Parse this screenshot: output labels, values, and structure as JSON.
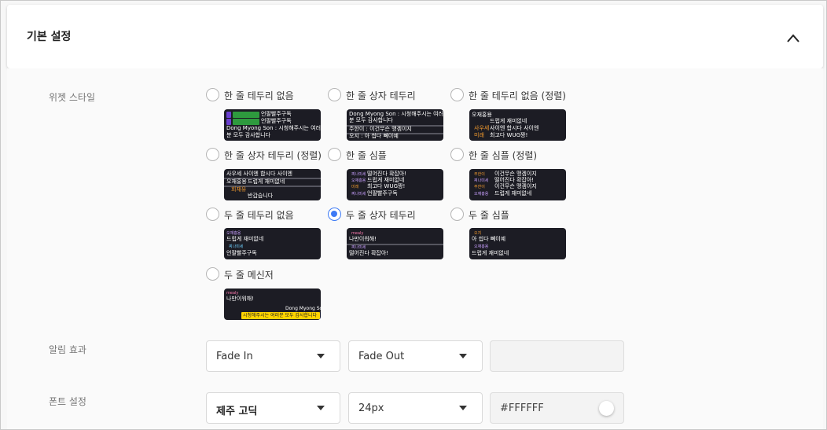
{
  "section": {
    "title": "기본 설정",
    "collapse_icon": "chevron-up-icon"
  },
  "widget_style": {
    "label": "위젯 스타일",
    "selected": "두 줄 상자 테두리",
    "options": [
      {
        "label": "한 줄 테두리 없음",
        "checked": false
      },
      {
        "label": "한 줄 상자 테두리",
        "checked": false
      },
      {
        "label": "한 줄 테두리 없음 (정렬)",
        "checked": false
      },
      {
        "label": "한 줄 상자 테두리 (정렬)",
        "checked": false
      },
      {
        "label": "한 줄 심플",
        "checked": false
      },
      {
        "label": "한 줄 심플 (정렬)",
        "checked": false
      },
      {
        "label": "두 줄 테두리 없음",
        "checked": false
      },
      {
        "label": "두 줄 상자 테두리",
        "checked": true
      },
      {
        "label": "두 줄 심플",
        "checked": false
      },
      {
        "label": "두 줄 메신저",
        "checked": false
      }
    ],
    "previews": {
      "p1": [
        "Dong Myong Son : 시청해주시는 여러",
        "분 모두 감사합니다",
        "언팔빨주구독",
        "언팔빨주구독"
      ],
      "p2": [
        "Dong Myong Son : 시청해주시는 여러",
        "분 모두 감사합니다",
        "주한이 : 이건무슨 맹겜이지",
        "오지 : 아 씹다 뻬이예"
      ],
      "p3": [
        "오재홍용",
        "드럽게 재미없네",
        "사우세",
        "사이엔 합시다 사이엔",
        "미래",
        "최고다 WUG짱!"
      ],
      "p4": [
        "사우세 사이엔 합시다 사이엔",
        "오재홍용",
        "드럽게 재미없네",
        "회재유",
        "반갑습니다"
      ],
      "p5": [
        "찌나미세",
        "떨어진다 확잡아!",
        "오재홍용",
        "드럽게 재미없네",
        "미래",
        "최고다 WUG짱!",
        "찌나미세",
        "언팔빨주구독"
      ],
      "p6": [
        "주한이",
        "이건무슨 맹겜이지",
        "찌나미세",
        "떨어진다 확잡아!",
        "주한이",
        "이건무슨 맹겜이지",
        "오재홍용",
        "드럽게 재미없네"
      ],
      "p7": [
        "오재홍용",
        "드럽게 재미없네",
        "찌나미세",
        "언팔빨주구독"
      ],
      "p8": [
        "mealy",
        "나만이워해!",
        "찌나미세",
        "떨어진다 확잡아!"
      ],
      "p9": [
        "오지",
        "아 씹다 뻬이예",
        "오재홍용",
        "드럽게 재미없네"
      ],
      "p10": [
        "mealy",
        "나만이워해!",
        "Dong Myong Son",
        "시청해주시는 여러분 모두 감사합니다"
      ]
    }
  },
  "alert_effect": {
    "label": "알림 효과",
    "in_value": "Fade In",
    "out_value": "Fade Out",
    "extra_value": ""
  },
  "font_settings": {
    "label": "폰트 설정",
    "font_value": "제주 고딕",
    "size_value": "24px",
    "color_value": "#FFFFFF"
  },
  "colors": {
    "accent": "#3d7af5",
    "preview_bg": "#1c1c24",
    "tag_purple": "#6b3fd1",
    "tag_green": "#2e9a3e",
    "tag_yellow": "#ffd400"
  }
}
